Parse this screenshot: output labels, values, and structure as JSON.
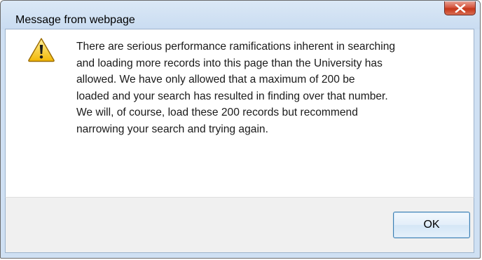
{
  "dialog": {
    "title": "Message from webpage",
    "close_icon": "close-x-icon",
    "warning_icon": "warning-triangle-icon",
    "message_lines": [
      "There are serious performance ramifications inherent in searching",
      "and loading more records into this page than the University has",
      "allowed. We have only allowed that a maximum of 200 be",
      "loaded and your search has resulted in finding over that number.",
      "We will, of course, load these 200 records but recommend",
      "narrowing your search and trying again."
    ],
    "ok_label": "OK"
  },
  "colors": {
    "titlebar": "#cfe0f3",
    "close_button": "#c94f3b",
    "content_bg": "#ffffff",
    "footer_bg": "#f0f0f0",
    "ok_border": "#3c7fb1",
    "warning_yellow": "#f2c50f"
  }
}
